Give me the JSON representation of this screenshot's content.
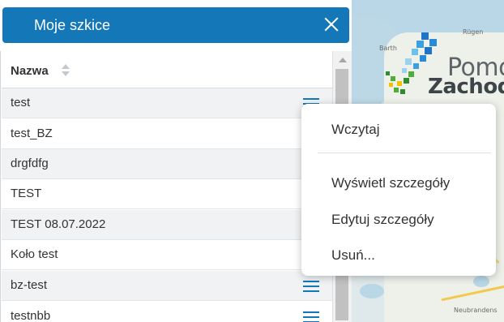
{
  "panel": {
    "title": "Moje szkice",
    "close_icon": "close-icon"
  },
  "table": {
    "column_header": "Nazwa",
    "sort_icon": "sort-icon",
    "rows": [
      {
        "name": "test"
      },
      {
        "name": "test_BZ"
      },
      {
        "name": "drgfdfg"
      },
      {
        "name": "TEST"
      },
      {
        "name": "TEST 08.07.2022"
      },
      {
        "name": "Koło test"
      },
      {
        "name": "bz-test"
      },
      {
        "name": "testnbb"
      }
    ],
    "row_menu_icon": "hamburger-menu-icon"
  },
  "context_menu": {
    "items": [
      "Wczytaj",
      "Wyświetl szczegóły",
      "Edytuj szczegóły",
      "Usuń..."
    ]
  },
  "map": {
    "logo_line1": "Pomo",
    "logo_line2": "Zachodn",
    "place_labels": [
      "Rügen",
      "Barth",
      "Neubrandens"
    ]
  },
  "colors": {
    "accent": "#1478b8",
    "header_text": "#ffffff"
  }
}
